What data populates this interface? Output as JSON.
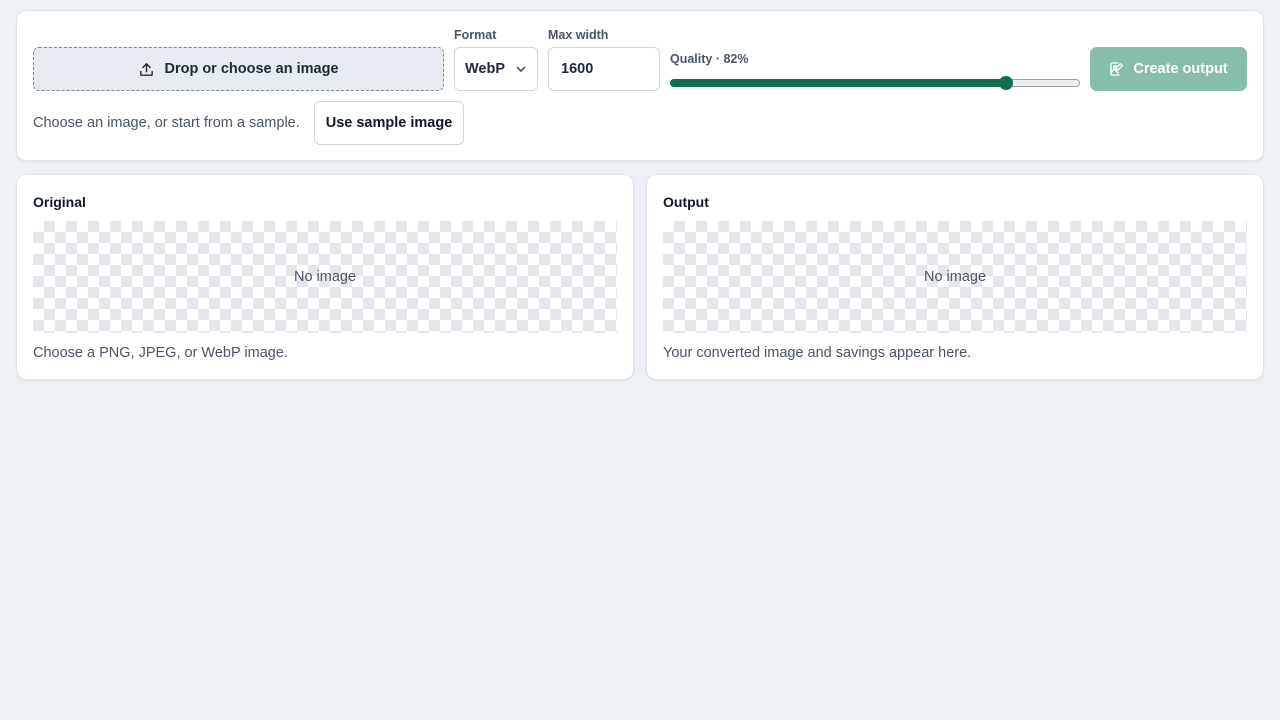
{
  "controls": {
    "dropzone_label": "Drop or choose an image",
    "dropzone_icon": "upload-icon",
    "format_label": "Format",
    "format_value": "WebP",
    "max_width_label": "Max width",
    "max_width_value": "1600",
    "quality_label": "Quality · 82%",
    "quality_value": 82,
    "create_label": "Create output",
    "create_icon": "image-edit-icon",
    "hint": "Choose an image, or start from a sample.",
    "sample_label": "Use sample image"
  },
  "panels": {
    "original": {
      "title": "Original",
      "empty": "No image",
      "caption": "Choose a PNG, JPEG, or WebP image."
    },
    "output": {
      "title": "Output",
      "empty": "No image",
      "caption": "Your converted image and savings appear here."
    }
  },
  "colors": {
    "accent": "#0f6e51",
    "accent_disabled": "#86bdac",
    "background": "#edf0f4"
  }
}
